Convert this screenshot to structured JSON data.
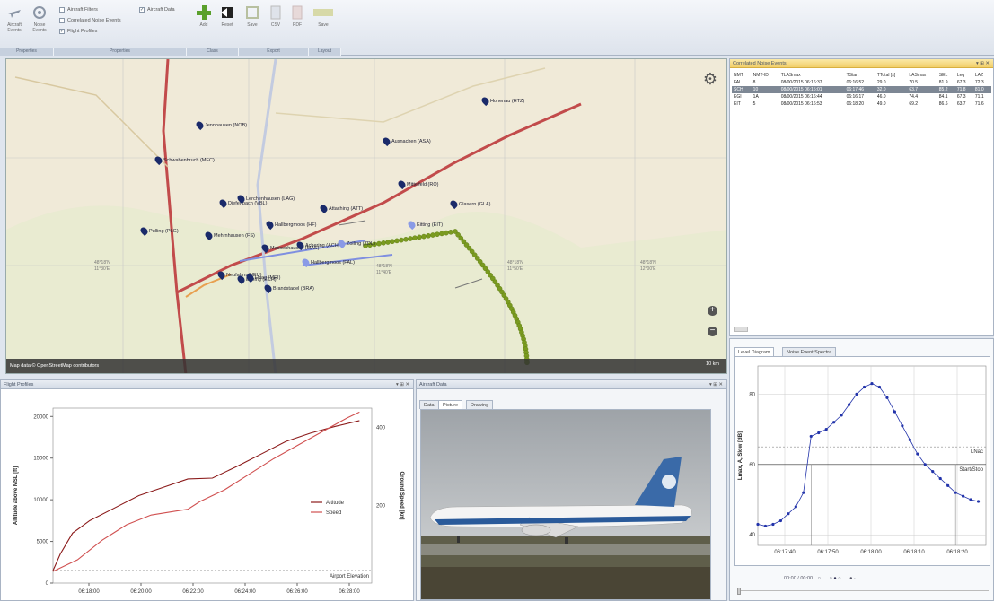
{
  "ribbon": {
    "left_buttons": [
      {
        "label": "Aircraft\nEvents",
        "icon": "airplane-icon"
      },
      {
        "label": "Noise\nEvents",
        "icon": "noise-events-icon"
      }
    ],
    "checkboxes": [
      {
        "label": "Aircraft Filters",
        "checked": false
      },
      {
        "label": "Correlated Noise Events",
        "checked": false
      },
      {
        "label": "Flight Profiles",
        "checked": true
      },
      {
        "label": "Aircraft Data",
        "checked": true
      }
    ],
    "buttons": [
      {
        "label": "Add",
        "icon": "add-icon"
      },
      {
        "label": "Reset",
        "icon": "reset-icon"
      },
      {
        "label": "Save",
        "icon": "save-icon"
      },
      {
        "label": "CSV",
        "icon": "csv-icon"
      },
      {
        "label": "PDF",
        "icon": "pdf-icon"
      },
      {
        "label": "Save",
        "icon": "layout-icon"
      }
    ],
    "groups": [
      "Properties",
      "Properties",
      "Class",
      "Export",
      "Layout"
    ]
  },
  "map": {
    "attribution": "Map data © OpenStreetMap contributors",
    "scale_label": "10 km",
    "places": [
      {
        "name": "Hohenau (HTZ)",
        "icon": "map-pin-icon"
      },
      {
        "name": "Jennhausen (NOB)",
        "icon": "map-pin-icon"
      },
      {
        "name": "Ausnachen (ASA)",
        "icon": "map-pin-icon"
      },
      {
        "name": "Schwabenbruch (MEC)",
        "icon": "map-pin-icon"
      },
      {
        "name": "Diefenbach (VBL)",
        "icon": "map-pin-icon"
      },
      {
        "name": "Mittelfeld (RO)",
        "icon": "map-pin-icon"
      },
      {
        "name": "Lerchenhausen (LAG)",
        "icon": "map-pin-icon"
      },
      {
        "name": "Attaching (ATT)",
        "icon": "map-pin-icon"
      },
      {
        "name": "Glasern (GLA)",
        "icon": "map-pin-icon"
      },
      {
        "name": "Hallbergmoos (HF)",
        "icon": "map-pin-icon"
      },
      {
        "name": "Eitting (EIT)",
        "icon": "map-pin-icon"
      },
      {
        "name": "Pulling (PLG)",
        "icon": "map-pin-icon"
      },
      {
        "name": "Mehrnhausen (FS)",
        "icon": "map-pin-icon"
      },
      {
        "name": "Massenhausen (MAS)",
        "icon": "map-pin-icon"
      },
      {
        "name": "Achering (ACH)",
        "icon": "map-pin-icon"
      },
      {
        "name": "Zolling (ZDL)",
        "icon": "map-pin-icon"
      },
      {
        "name": "Hallbergmoos (FAL)",
        "icon": "map-pin-icon"
      },
      {
        "name": "Neufahrn (NEU)",
        "icon": "map-pin-icon"
      },
      {
        "name": "Eching (ECH)",
        "icon": "map-pin-icon"
      },
      {
        "name": "Haag (MRI)",
        "icon": "map-pin-icon"
      },
      {
        "name": "Brandstadel (BRA)",
        "icon": "map-pin-icon"
      }
    ],
    "coords": [
      "48°18'N\n11°30'E",
      "48°18'N\n11°40'E",
      "48°18'N\n11°50'E",
      "48°18'N\n12°00'E"
    ]
  },
  "correlated": {
    "title": "Correlated Noise Events",
    "columns": [
      "NMT",
      "NMT-ID",
      "TLASmax",
      "TStart",
      "TTotal [s]",
      "LASmax",
      "SEL",
      "Leq",
      "LAZ"
    ],
    "rows": [
      [
        "FAL",
        "8",
        "08/00/2015 06:16:37",
        "06:16:52",
        "29.0",
        "70.5",
        "81.9",
        "67.3",
        "72.3"
      ],
      [
        "SCH",
        "10",
        "08/00/2015 06:15:01",
        "06:17:46",
        "32.0",
        "63.7",
        "85.2",
        "71.8",
        "81.0"
      ],
      [
        "EGI",
        "1A",
        "08/00/2015 06:16:44",
        "06:16:17",
        "46.0",
        "74.4",
        "84.1",
        "67.3",
        "71.1"
      ],
      [
        "EIT",
        "5",
        "08/00/2015 06:16:53",
        "06:18:20",
        "49.0",
        "69.2",
        "86.6",
        "63.7",
        "71.6"
      ]
    ],
    "selected_row": 1
  },
  "level_panel": {
    "tabs": [
      "Level Diagram",
      "Noise Event Spectra"
    ],
    "active_tab": 0,
    "player": "00:00 / 00:00"
  },
  "flight_panel": {
    "title": "Flight Profiles"
  },
  "aircraft_panel": {
    "title": "Aircraft Data",
    "tabs": [
      "Data",
      "Picture",
      "Drawing"
    ],
    "active_tab": 1
  },
  "chart_data": [
    {
      "type": "line",
      "title": "",
      "xlabel": "",
      "ylabel": "Altitude above MSL [ft]",
      "y2label": "Ground Speed [kn]",
      "x_ticks": [
        "06:18:00",
        "06:20:00",
        "06:22:00",
        "06:24:00",
        "06:26:00",
        "06:28:00"
      ],
      "ylim": [
        0,
        21000
      ],
      "y_ticks": [
        0,
        5000,
        10000,
        15000,
        20000
      ],
      "y2lim": [
        0,
        450
      ],
      "y2_ticks": [
        200,
        400
      ],
      "legend_position": "right",
      "annotation": "Airport Elevation",
      "series": [
        {
          "name": "Altitude",
          "color": "#8b1a1a",
          "x": [
            0,
            0.3,
            0.8,
            1.5,
            2.5,
            3.5,
            4.5,
            5.5,
            6.5,
            7.5,
            8.5,
            9.5,
            10.5,
            11.5,
            12.5
          ],
          "values": [
            1500,
            3500,
            6000,
            7500,
            9000,
            10500,
            11500,
            12500,
            12600,
            14000,
            15500,
            17000,
            18000,
            18800,
            19500
          ]
        },
        {
          "name": "Speed",
          "color": "#d05050",
          "x": [
            0,
            1,
            2,
            3,
            4,
            5,
            5.5,
            6,
            7,
            8,
            9,
            10,
            11,
            12,
            12.5
          ],
          "values": [
            30,
            60,
            110,
            150,
            175,
            185,
            190,
            210,
            240,
            280,
            320,
            355,
            390,
            425,
            440
          ]
        }
      ]
    },
    {
      "type": "line",
      "ylabel": "Lmax, A, Slow [dB]",
      "x_ticks": [
        "06:17:40",
        "06:17:50",
        "06:18:00",
        "06:18:10",
        "06:18:20"
      ],
      "y_ticks": [
        40,
        60,
        80
      ],
      "ylim": [
        37,
        88
      ],
      "annotations": [
        "LNac",
        "Start/Stop"
      ],
      "series": [
        {
          "name": "",
          "color": "#2233aa",
          "x": [
            0,
            3,
            6,
            9,
            12,
            15,
            18,
            21,
            24,
            27,
            30,
            33,
            36,
            39,
            42,
            45,
            48,
            51,
            54,
            57,
            60,
            63,
            66,
            69,
            72,
            75,
            78,
            81,
            84,
            87
          ],
          "values": [
            43,
            42.5,
            43,
            44,
            46,
            48,
            52,
            68,
            69,
            70,
            72,
            74,
            77,
            80,
            82,
            83,
            82,
            79,
            75,
            71,
            67,
            63,
            60,
            58,
            56,
            54,
            52,
            51,
            50,
            49.5
          ]
        }
      ]
    }
  ]
}
